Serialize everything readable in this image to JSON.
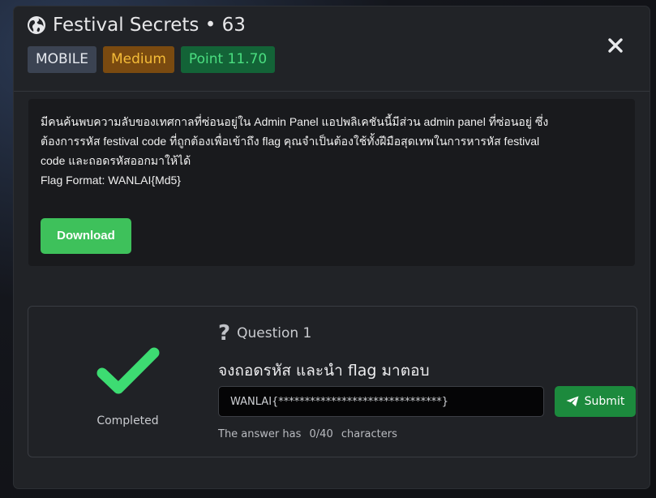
{
  "modal": {
    "title": "Festival Secrets • 63",
    "badges": {
      "category": "MOBILE",
      "difficulty": "Medium",
      "points": "Point 11.70"
    },
    "icons": {
      "title": "globe-icon",
      "close": "close-icon"
    }
  },
  "description": {
    "line1": "มีคนค้นพบความลับของเทศกาลที่ซ่อนอยู่ใน Admin Panel แอปพลิเคชันนี้มีส่วน admin panel ที่ซ่อนอยู่ ซึ่ง",
    "line2": "ต้องการรหัส festival code ที่ถูกต้องเพื่อเข้าถึง flag คุณจำเป็นต้องใช้ทั้งฝีมือสุดเทพในการหารหัส festival",
    "line3": "code และถอดรหัสออกมาให้ได้",
    "flag_format": "Flag Format: WANLAI{Md5}",
    "download_label": "Download"
  },
  "question": {
    "status_label": "Completed",
    "title": "Question 1",
    "text": "จงถอดรหัส และนำ flag มาตอบ",
    "answer_placeholder": "WANLAI{*******************************}",
    "submit_label": "Submit",
    "count_prefix": "The answer has",
    "count_value": "0/40",
    "count_suffix": "characters",
    "icons": {
      "status": "checkmark-icon",
      "question": "question-mark-icon",
      "submit": "send-icon"
    }
  },
  "colors": {
    "accent_green": "#3ec15b",
    "submit_green": "#1c8a3d",
    "medium_badge_text": "#f5bc38",
    "point_badge_text": "#4ade80"
  }
}
